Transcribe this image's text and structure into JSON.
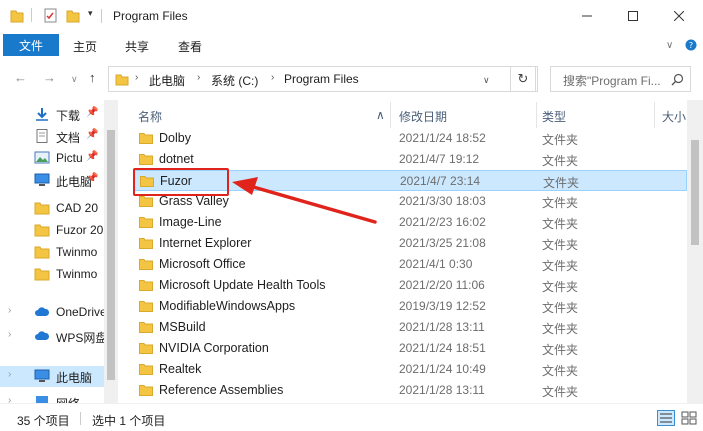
{
  "window": {
    "title": "Program Files"
  },
  "ribbon": {
    "tabs": [
      "文件",
      "主页",
      "共享",
      "查看"
    ]
  },
  "address": {
    "segments": [
      "此电脑",
      "系统 (C:)",
      "Program Files"
    ],
    "search_placeholder": "搜索\"Program Fi..."
  },
  "nav_pane": {
    "items": [
      {
        "label": "下载",
        "icon": "download-icon",
        "pinned": true
      },
      {
        "label": "文档",
        "icon": "document-icon",
        "pinned": true
      },
      {
        "label": "Pictu",
        "icon": "pictures-icon",
        "pinned": true
      },
      {
        "label": "此电脑",
        "icon": "computer-icon",
        "pinned": true
      },
      {
        "label": "CAD 20",
        "icon": "folder-icon",
        "pinned": false
      },
      {
        "label": "Fuzor 20",
        "icon": "folder-icon",
        "pinned": false
      },
      {
        "label": "Twinmo",
        "icon": "folder-icon",
        "pinned": false
      },
      {
        "label": "Twinmo",
        "icon": "folder-icon",
        "pinned": false
      },
      {
        "label": "OneDrive",
        "icon": "cloud-icon",
        "pinned": false
      },
      {
        "label": "WPS网盘",
        "icon": "cloud-icon",
        "pinned": false
      },
      {
        "label": "此电脑",
        "icon": "computer-icon",
        "pinned": false
      },
      {
        "label": "网络",
        "icon": "network-icon",
        "pinned": false
      }
    ]
  },
  "columns": {
    "name": "名称",
    "date": "修改日期",
    "type": "类型",
    "size": "大小"
  },
  "files": [
    {
      "name": "Dolby",
      "date": "2021/1/24 18:52",
      "type": "文件夹"
    },
    {
      "name": "dotnet",
      "date": "2021/4/7 19:12",
      "type": "文件夹"
    },
    {
      "name": "Fuzor",
      "date": "2021/4/7 23:14",
      "type": "文件夹",
      "selected": true
    },
    {
      "name": "Grass Valley",
      "date": "2021/3/30 18:03",
      "type": "文件夹"
    },
    {
      "name": "Image-Line",
      "date": "2021/2/23 16:02",
      "type": "文件夹"
    },
    {
      "name": "Internet Explorer",
      "date": "2021/3/25 21:08",
      "type": "文件夹"
    },
    {
      "name": "Microsoft Office",
      "date": "2021/4/1 0:30",
      "type": "文件夹"
    },
    {
      "name": "Microsoft Update Health Tools",
      "date": "2021/2/20 11:06",
      "type": "文件夹"
    },
    {
      "name": "ModifiableWindowsApps",
      "date": "2019/3/19 12:52",
      "type": "文件夹"
    },
    {
      "name": "MSBuild",
      "date": "2021/1/28 13:11",
      "type": "文件夹"
    },
    {
      "name": "NVIDIA Corporation",
      "date": "2021/1/24 18:51",
      "type": "文件夹"
    },
    {
      "name": "Realtek",
      "date": "2021/1/24 10:49",
      "type": "文件夹"
    },
    {
      "name": "Reference Assemblies",
      "date": "2021/1/28 13:11",
      "type": "文件夹"
    }
  ],
  "status": {
    "count": "35 个项目",
    "selected": "选中 1 个项目"
  },
  "colors": {
    "accent": "#1979ca",
    "selection": "#cce8ff",
    "annotation": "#e0241b",
    "folder": "#f4c542"
  }
}
